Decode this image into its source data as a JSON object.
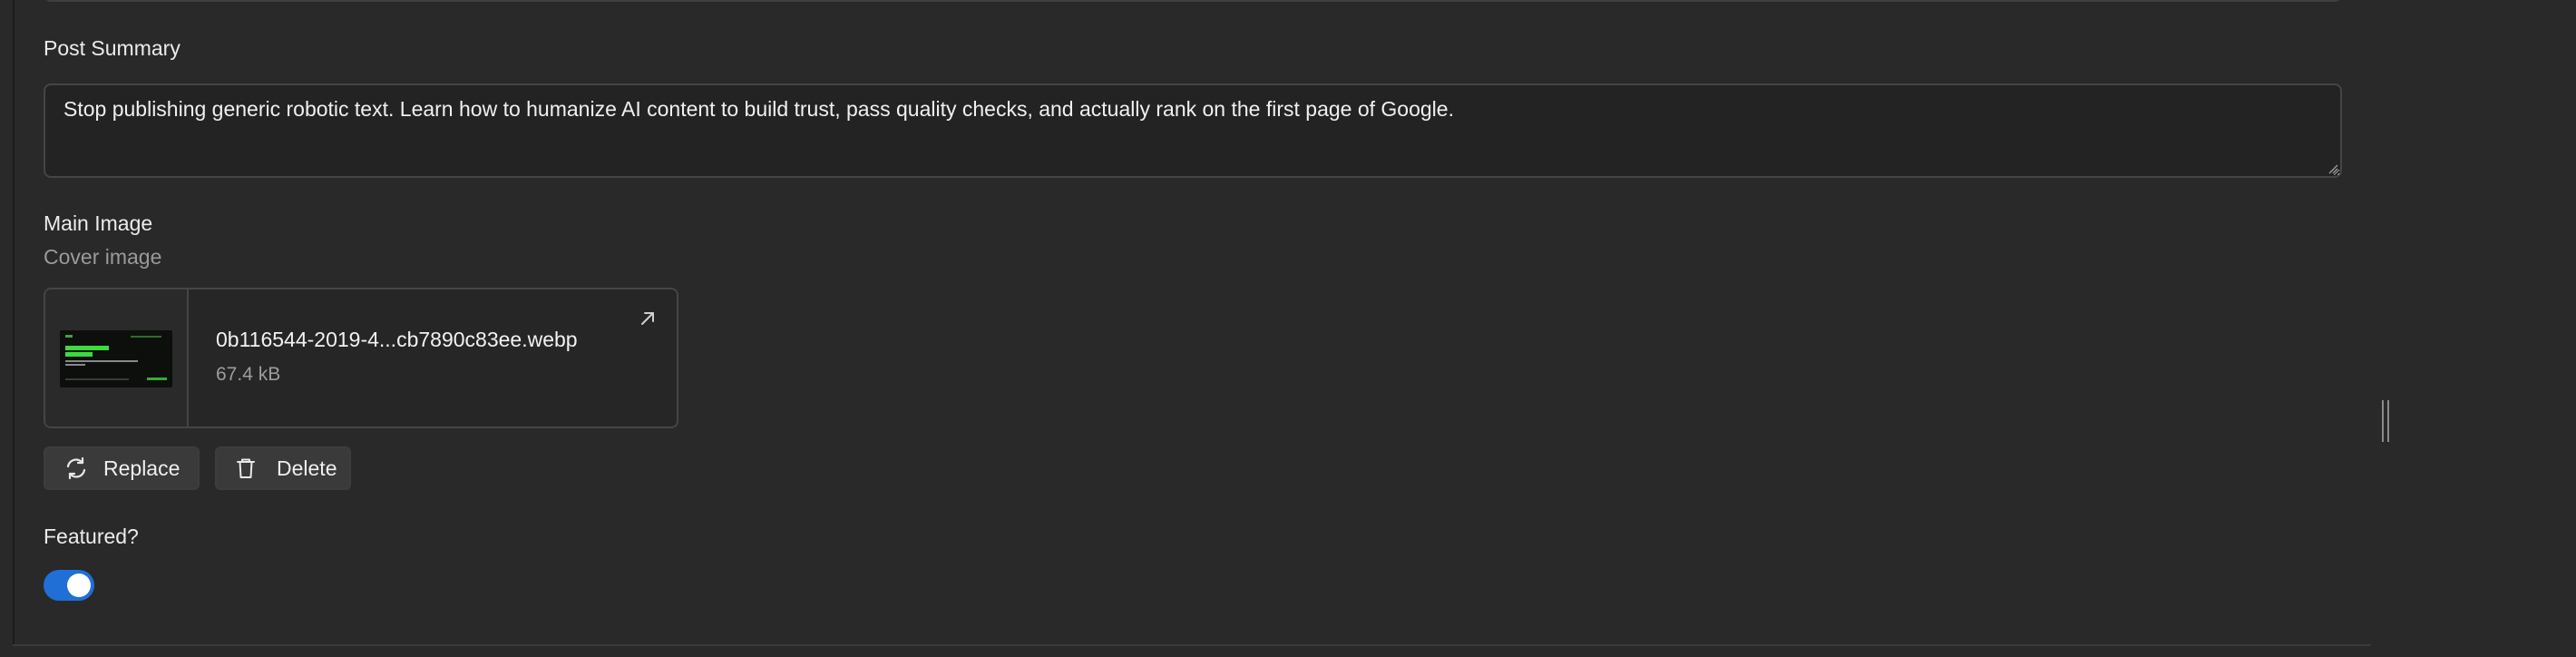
{
  "post_summary": {
    "label": "Post Summary",
    "value": "Stop publishing generic robotic text. Learn how to humanize AI content to build trust, pass quality checks, and actually rank on the first page of Google."
  },
  "main_image": {
    "label": "Main Image",
    "sublabel": "Cover image",
    "file_name": "0b116544-2019-4...cb7890c83ee.webp",
    "file_size": "67.4 kB",
    "open_icon": "arrow-up-right-icon",
    "replace_label": "Replace",
    "replace_icon": "refresh-icon",
    "delete_label": "Delete",
    "delete_icon": "trash-icon"
  },
  "featured": {
    "label": "Featured?",
    "enabled": true
  },
  "colors": {
    "background": "#292929",
    "field_background": "#232323",
    "toggle_on": "#1f6fd6",
    "thumbnail_accent": "#3ddc3d"
  }
}
